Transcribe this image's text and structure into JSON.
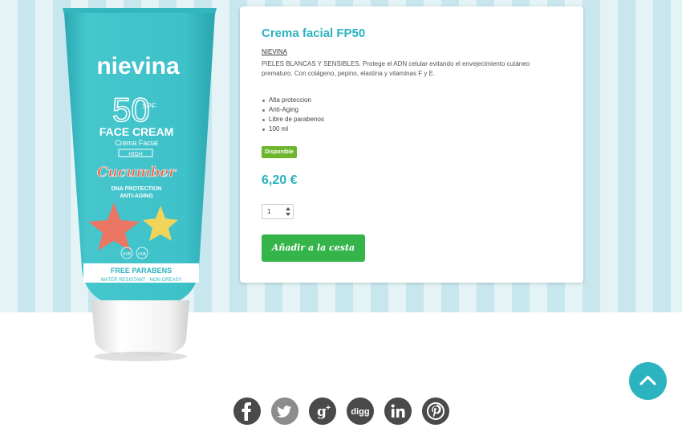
{
  "product": {
    "title": "Crema facial FP50",
    "brand": "NIEVINA",
    "description": "PIELES BLANCAS Y SENSIBLES. Protege el ADN celular evitando el envejecimiento cutáneo prematuro. Con colágeno, pepino, elastina y vitaminas F y E.",
    "features": [
      "Alta proteccion",
      "Anti-Aging",
      "Libre de parabenos",
      "100 ml"
    ],
    "availability": "Disponible",
    "price": "6,20 €",
    "quantity": "1",
    "add_to_cart": "Añadir a la cesta"
  },
  "packaging": {
    "brand": "nievina",
    "spf_number": "50",
    "spf_label": "SPF",
    "name": "FACE CREAM",
    "subname": "Crema Facial",
    "level": "HIGH",
    "flavor": "Cucumber",
    "claim1": "DNA PROTECTION",
    "claim2": "ANTI-AGING",
    "uvb": "UVB",
    "uva": "UVA",
    "free": "FREE PARABENS",
    "footer": "WATER RESISTANT · NON GREASY"
  },
  "share": [
    "facebook-icon",
    "twitter-icon",
    "google-plus-icon",
    "digg-icon",
    "linkedin-icon",
    "pinterest-icon"
  ],
  "colors": {
    "accent": "#2bb3c0",
    "button": "#35b44a",
    "badge": "#6cb52d",
    "tube": "#3ec1c9"
  }
}
